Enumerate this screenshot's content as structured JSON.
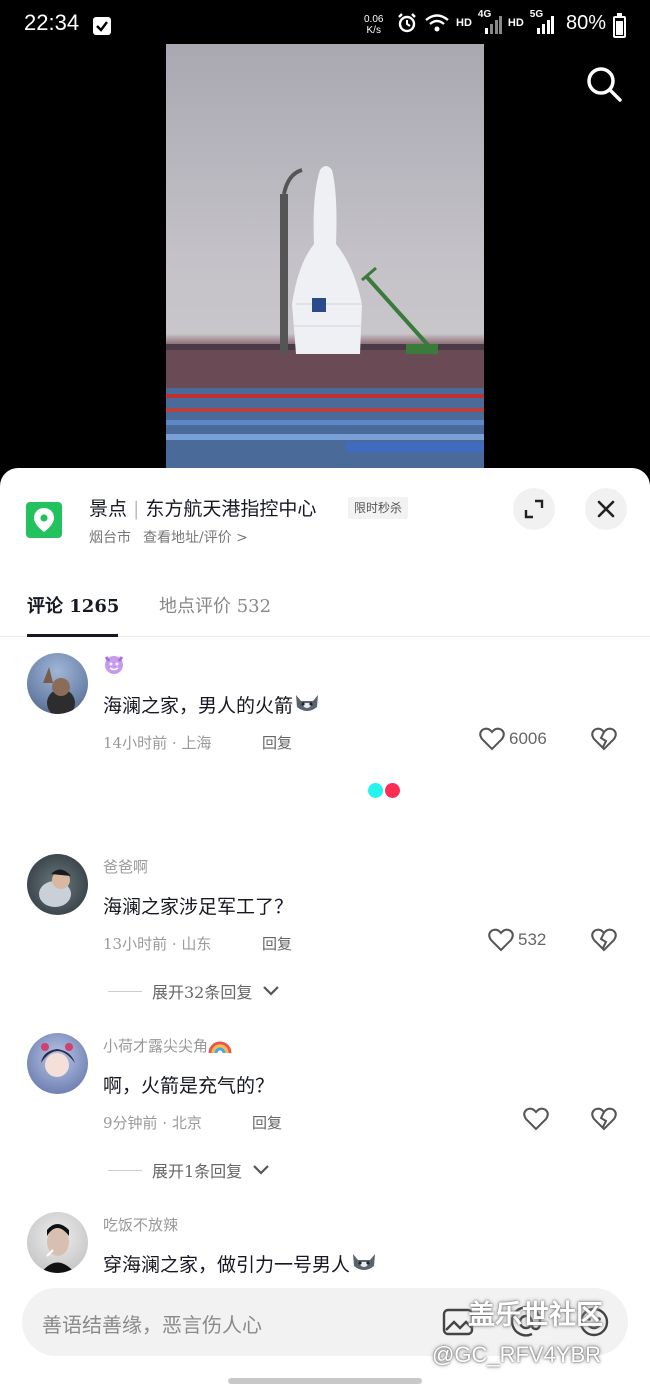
{
  "status_bar": {
    "time": "22:34",
    "net_speed_value": "0.06",
    "net_speed_unit": "K/s",
    "hd1": "HD",
    "sig1": "4G",
    "hd2": "HD",
    "sig2": "5G",
    "battery": "80%"
  },
  "poi": {
    "category": "景点",
    "name": "东方航天港指控中心",
    "badge": "限时秒杀",
    "city": "烟台市",
    "link": "查看地址/评价 >"
  },
  "tabs": {
    "comments": "评论 1265",
    "reviews": "地点评价 532"
  },
  "comments": [
    {
      "user": "",
      "text": "海澜之家，男人的火箭",
      "time_loc": "14小时前 · 上海",
      "reply": "回复",
      "likes": "6006"
    },
    {
      "user": "爸爸啊",
      "text": "海澜之家涉足军工了？",
      "time_loc": "13小时前 · 山东",
      "reply": "回复",
      "likes": "532",
      "expand": "展开32条回复"
    },
    {
      "user": "小荷才露尖尖角",
      "text": "啊，火箭是充气的？",
      "time_loc": "9分钟前 · 北京",
      "reply": "回复",
      "likes": "",
      "expand": "展开1条回复"
    },
    {
      "user": "吃饭不放辣",
      "text": "穿海澜之家，做引力一号男人",
      "time_loc": "",
      "reply": "",
      "likes": ""
    }
  ],
  "input": {
    "placeholder": "善语结善缘，恶言伤人心"
  },
  "watermark": {
    "line1": "盖乐世社区",
    "line2": "@GC_RFV4YBR"
  },
  "colors": {
    "accent_green": "#24c15f",
    "dot_cyan": "#25f4ee",
    "dot_red": "#fe2c55"
  }
}
